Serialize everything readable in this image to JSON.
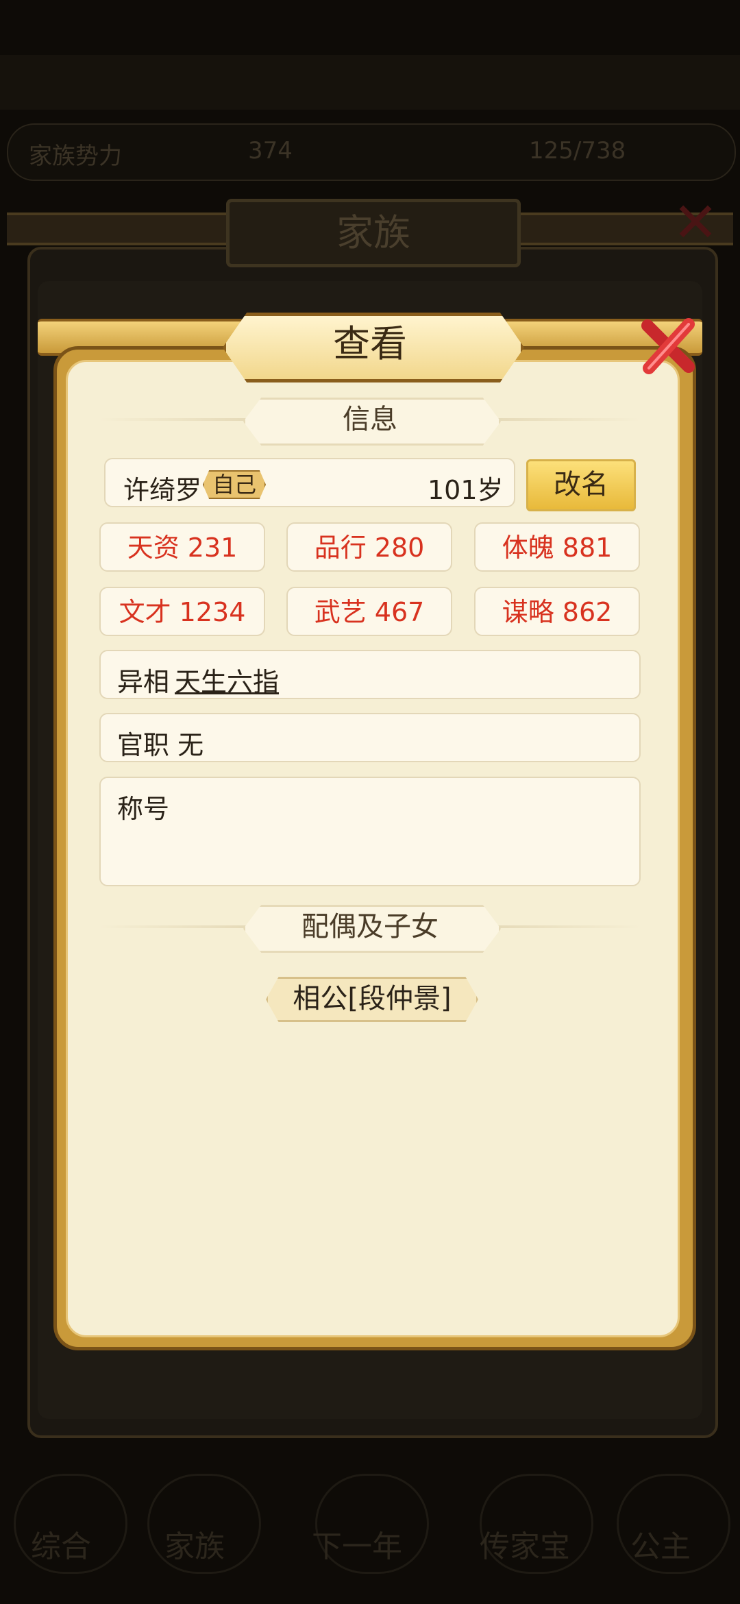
{
  "background": {
    "stat_left": "家族势力",
    "stat_mid": "374",
    "stat_right": "125/738",
    "window_title": "家族",
    "nav": [
      "综合",
      "家族",
      "下一年",
      "传家宝",
      "公主"
    ]
  },
  "modal": {
    "title": "查看",
    "info_section": "信息",
    "name": "许绮罗",
    "self_badge": "自己",
    "age": "101岁",
    "rename_label": "改名",
    "attributes": [
      {
        "label": "天资 231"
      },
      {
        "label": "品行 280"
      },
      {
        "label": "体魄 881"
      },
      {
        "label": "文才 1234"
      },
      {
        "label": "武艺 467"
      },
      {
        "label": "谋略 862"
      }
    ],
    "trait_label": "异相",
    "trait_value": "天生六指",
    "office_label": "官职 无",
    "titles_label": "称号",
    "family_section": "配偶及子女",
    "spouse": "相公[段仲景]"
  },
  "colors": {
    "attribute_text": "#d8321f",
    "panel": "#f6efd4",
    "gold": "#c99a3a"
  }
}
